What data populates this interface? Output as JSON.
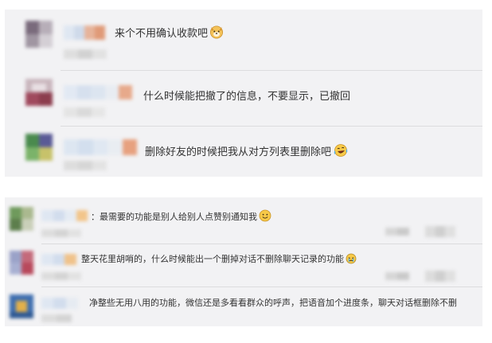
{
  "top_comments": [
    {
      "text": "来个不用确认收款吧",
      "emoji": "dog-emoji"
    },
    {
      "text": "什么时候能把撤了的信息，不要显示，已撤回",
      "emoji": ""
    },
    {
      "text": "删除好友的时候把我从对方列表里删除吧",
      "emoji": "laughing-crying-emoji"
    }
  ],
  "bottom_comments": [
    {
      "text": "：最需要的功能是别人给别人点赞别通知我",
      "emoji": "smile-emoji"
    },
    {
      "text": "整天花里胡哨的，什么时候能出一个删掉对话不删除聊天记录的功能",
      "emoji": "crying-emoji"
    },
    {
      "text": "净整些无用八用的功能，微信还是多看看群众的呼声，把语音加个进度条，聊天对话框删除不删",
      "emoji": ""
    }
  ],
  "colors": {
    "panel_bg": "#f2f2f4",
    "divider": "#dcdcde",
    "text": "#333333",
    "emoji_yellow": "#f7c948"
  }
}
